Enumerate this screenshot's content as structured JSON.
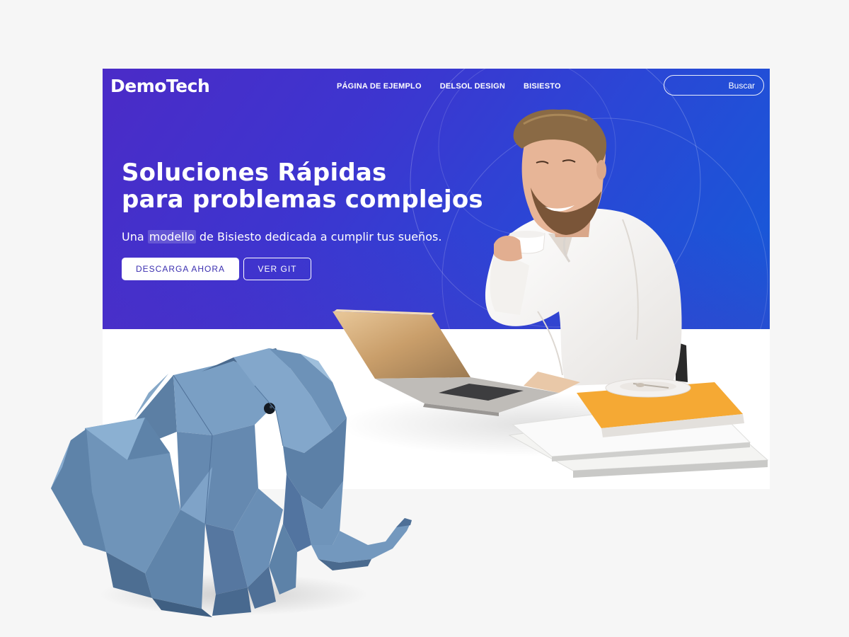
{
  "brand": {
    "logo_text": "DemoTech"
  },
  "nav": {
    "items": [
      {
        "label": "PÁGINA DE EJEMPLO"
      },
      {
        "label": "DELSOL DESIGN"
      },
      {
        "label": "BISIESTO"
      }
    ]
  },
  "search": {
    "button_label": "Buscar",
    "value": ""
  },
  "hero": {
    "headline_line1": "Soluciones Rápidas",
    "headline_line2": "para problemas complejos",
    "subtitle_before": "Una ",
    "subtitle_highlight": "modello",
    "subtitle_after": " de Bisiesto dedicada a cumplir tus sueños.",
    "primary_button": "DESCARGA AHORA",
    "secondary_button": "VER GIT"
  },
  "colors": {
    "hero_gradient_start": "#4b2bc7",
    "hero_gradient_end": "#155bd8",
    "primary_button_text": "#3b2fb0",
    "elephant": "#6e93b8",
    "page_background": "#f6f6f6"
  },
  "imagery": {
    "hero_photo": "man-with-coffee-and-laptop-photo",
    "foreground_object": "origami-elephant"
  }
}
